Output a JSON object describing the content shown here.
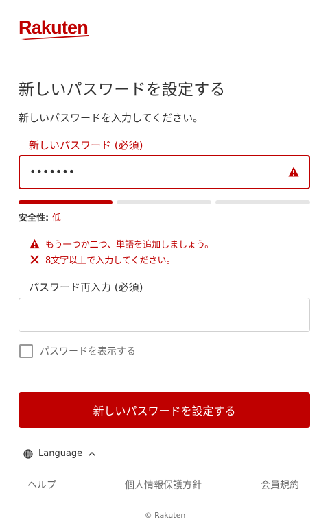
{
  "brand": {
    "logo_text": "Rakuten",
    "color": "#bf0000"
  },
  "page": {
    "title": "新しいパスワードを設定する",
    "subtitle": "新しいパスワードを入力してください。"
  },
  "new_password": {
    "label": "新しいパスワード (必須)",
    "value": "•••••••",
    "state": "error",
    "icon": "warning-icon"
  },
  "strength": {
    "key": "安全性: ",
    "level": "低",
    "segments_filled": 1,
    "segments_total": 3
  },
  "messages": [
    {
      "icon": "warning-icon",
      "text": "もう一つか二つ、単語を追加しましょう。"
    },
    {
      "icon": "close-icon",
      "text": "8文字以上で入力してください。"
    }
  ],
  "confirm_password": {
    "label": "パスワード再入力 (必須)",
    "value": ""
  },
  "show_password": {
    "label": "パスワードを表示する",
    "checked": false
  },
  "submit": {
    "label": "新しいパスワードを設定する"
  },
  "language": {
    "label": "Language",
    "icon": "globe-icon"
  },
  "footer": {
    "links": [
      "ヘルプ",
      "個人情報保護方針",
      "会員規約"
    ],
    "copyright": "© Rakuten"
  }
}
